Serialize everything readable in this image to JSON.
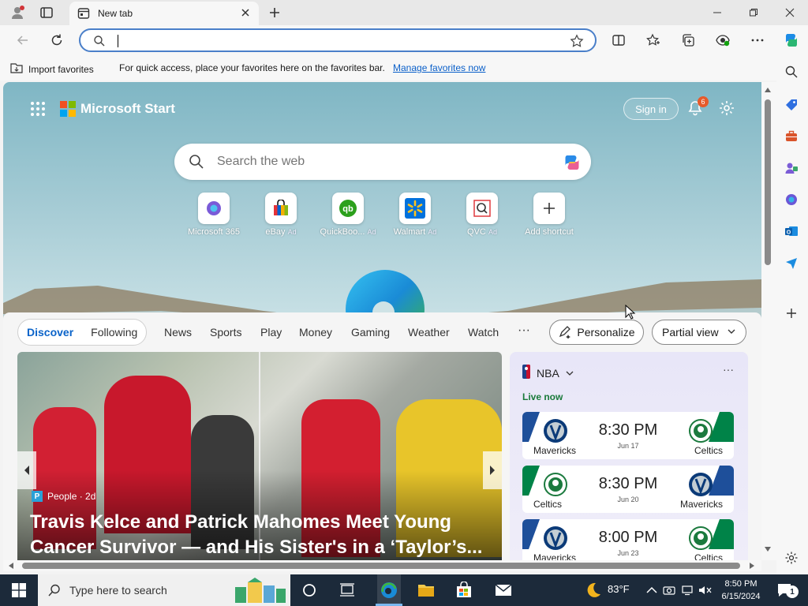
{
  "browser": {
    "tab_title": "New tab",
    "address_value": "",
    "address_placeholder": ""
  },
  "favorites_bar": {
    "import_label": "Import favorites",
    "message": "For quick access, place your favorites here on the favorites bar.",
    "manage_link": "Manage favorites now"
  },
  "ntp": {
    "brand": "Microsoft Start",
    "signin_label": "Sign in",
    "notification_count": "6",
    "search_placeholder": "Search the web",
    "shortcuts": [
      {
        "label": "Microsoft 365",
        "ad": ""
      },
      {
        "label": "eBay",
        "ad": "Ad"
      },
      {
        "label": "QuickBoo...",
        "ad": "Ad"
      },
      {
        "label": "Walmart",
        "ad": "Ad"
      },
      {
        "label": "QVC",
        "ad": "Ad"
      },
      {
        "label": "Add shortcut",
        "ad": ""
      }
    ]
  },
  "feed": {
    "pills": [
      "Discover",
      "Following"
    ],
    "nav": [
      "News",
      "Sports",
      "Play",
      "Money",
      "Gaming",
      "Weather",
      "Watch"
    ],
    "more": "···",
    "personalize": "Personalize",
    "view_select": "Partial view",
    "hero": {
      "source": "People · 2d",
      "headline": "Travis Kelce and Patrick Mahomes Meet Young Cancer Survivor — and His Sister's in a ‘Taylor’s..."
    },
    "nba": {
      "title": "NBA",
      "live_label": "Live now",
      "games": [
        {
          "left": "Mavericks",
          "right": "Celtics",
          "time": "8:30 PM",
          "date": "Jun 17"
        },
        {
          "left": "Celtics",
          "right": "Mavericks",
          "time": "8:30 PM",
          "date": "Jun 20"
        },
        {
          "left": "Mavericks",
          "right": "Celtics",
          "time": "8:00 PM",
          "date": "Jun 23"
        }
      ]
    }
  },
  "taskbar": {
    "search_placeholder": "Type here to search",
    "weather": "83°F",
    "time": "8:50 PM",
    "date": "6/15/2024",
    "notification_count": "1"
  },
  "colors": {
    "accent": "#0a63c9",
    "mavericks": "#1e4f9a",
    "celtics": "#008348",
    "taskbar": "#1c2a3a"
  }
}
